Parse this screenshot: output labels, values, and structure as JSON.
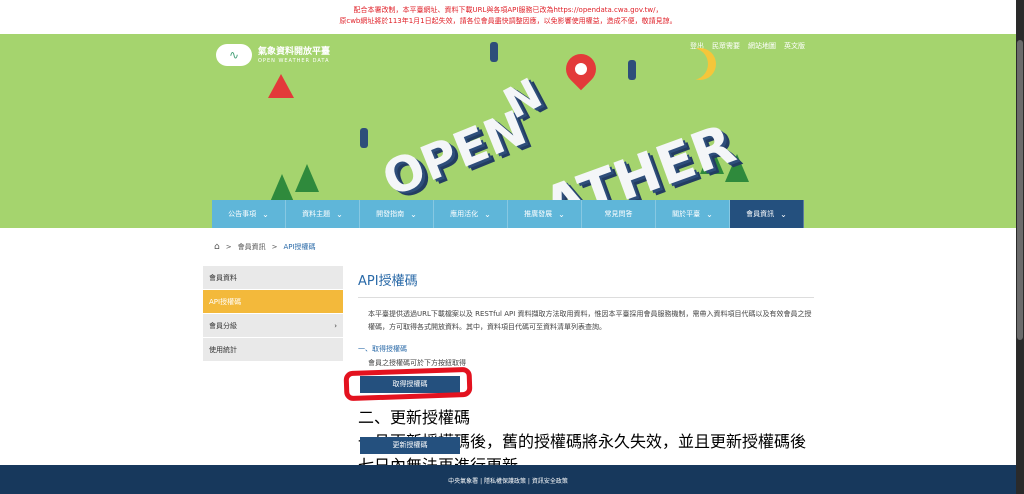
{
  "notice": {
    "line1": "配合本署改制，本平臺網址、資料下載URL與各項API服務已改為https://opendata.cwa.gov.tw/，",
    "line2": "原cwb網址將於113年1月1日起失效，請各位會員盡快調整因應，以免影響使用權益，造成不便，敬請見諒。"
  },
  "header": {
    "logo_title": "氣象資料開放平臺",
    "logo_sub": "OPEN WEATHER DATA",
    "links": [
      "登出",
      "民眾需要",
      "網站地圖",
      "英文版"
    ],
    "hero_words": [
      "OPEN",
      "ATHER",
      "N"
    ]
  },
  "nav": [
    {
      "label": "公告事項",
      "chev": "⌄"
    },
    {
      "label": "資料主題",
      "chev": "⌄"
    },
    {
      "label": "開發指南",
      "chev": "⌄"
    },
    {
      "label": "應用活化",
      "chev": "⌄"
    },
    {
      "label": "推廣發展",
      "chev": "⌄"
    },
    {
      "label": "常見問答",
      "chev": ""
    },
    {
      "label": "關於平臺",
      "chev": "⌄"
    },
    {
      "label": "會員資訊",
      "chev": "⌄"
    }
  ],
  "breadcrumb": {
    "home_icon": "⌂",
    "sep": ">",
    "level1": "會員資訊",
    "current": "API授權碼"
  },
  "sidebar": [
    "會員資料",
    "API授權碼",
    "會員分級",
    "使用統計"
  ],
  "main": {
    "title": "API授權碼",
    "intro": "本平臺提供透過URL下載檔案以及 RESTful API 資料擷取方法取用資料，惟因本平臺採用會員服務機制，需帶入資料項目代碼以及有效會員之授權碼，方可取得各式開放資料。其中，資料項目代碼可至資料清單列表查詢。",
    "sec1_title": "一、取得授權碼",
    "sec1_text": "會員之授權碼可於下方按鈕取得",
    "btn_get": "取得授權碼",
    "sec2_title": "二、更新授權碼",
    "sec2_text": "一旦更新授權碼後，舊的授權碼將永久失效，並且更新授權碼後七日內無法再進行更新。",
    "btn_update": "更新授權碼"
  },
  "footer": "中央氣象署 | 隱私權保護政策 | 資訊安全政策",
  "colors": {
    "banner": "#a5d46e",
    "nav": "#5fb6d9",
    "nav_active": "#24507e",
    "accent": "#f3b93b",
    "notice": "#e0222a"
  }
}
